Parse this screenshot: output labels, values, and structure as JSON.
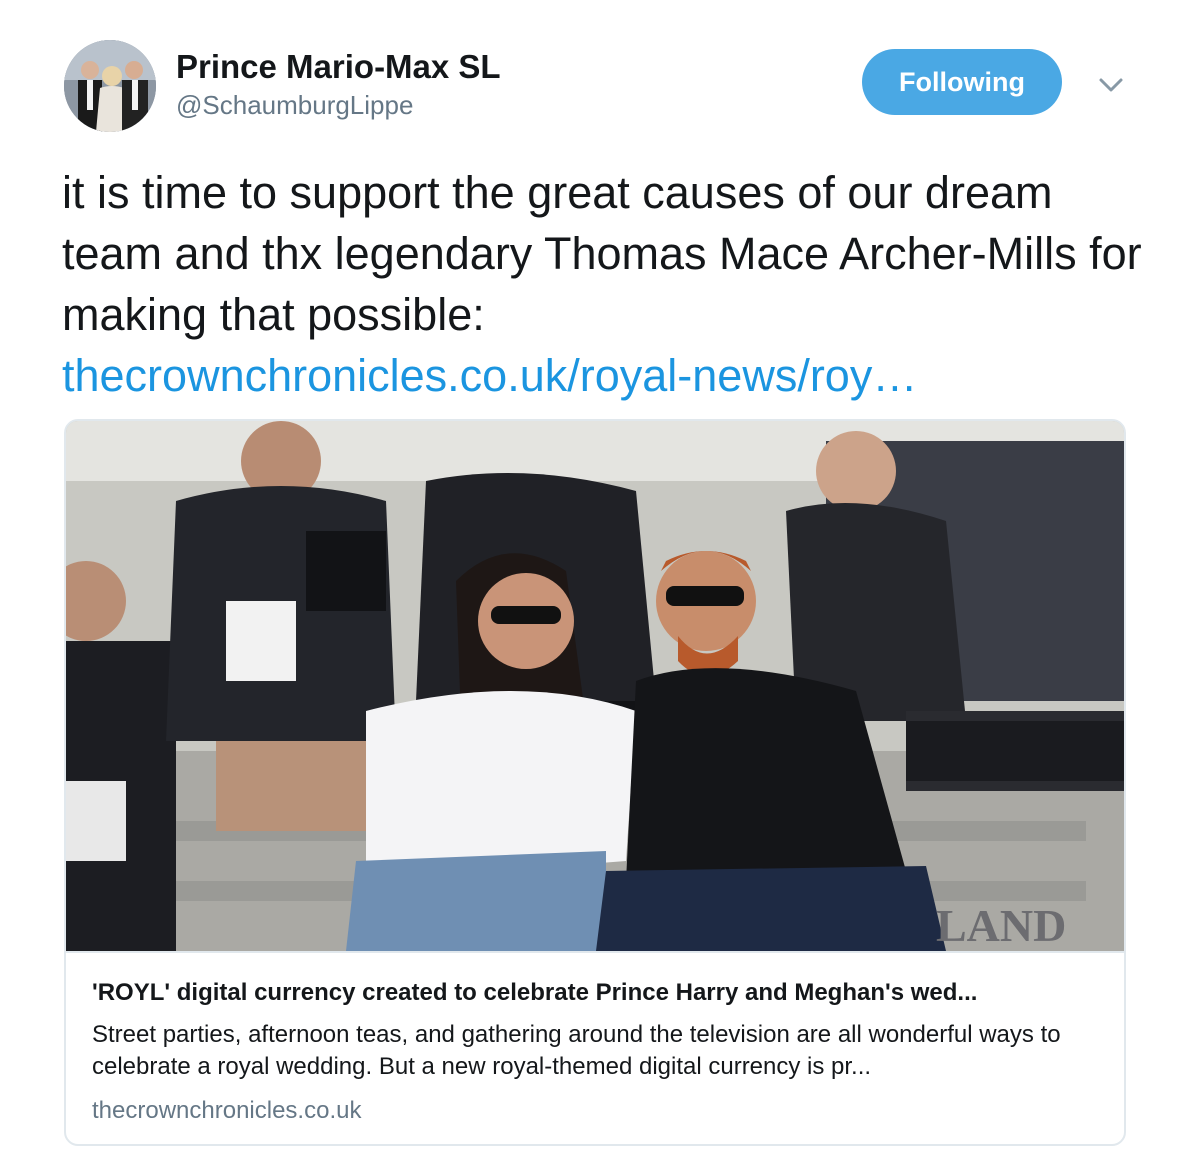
{
  "author": {
    "display_name": "Prince Mario-Max SL",
    "handle": "@SchaumburgLippe",
    "avatar_icon": "profile-photo"
  },
  "follow_button": {
    "label": "Following",
    "color": "#4aa8e4"
  },
  "menu_icon": "chevron-down-icon",
  "tweet": {
    "text": "it is time to support the great causes of our dream team and thx legendary Thomas Mace Archer-Mills for making that possible:",
    "link": "thecrownchronicles.co.uk/royal-news/roy…",
    "link_color": "#1b95e0"
  },
  "card": {
    "image_icon": "article-photo",
    "image_text": "LAND",
    "title": "'ROYL' digital currency created to celebrate Prince Harry and Meghan's wed...",
    "description": "Street parties, afternoon teas, and gathering around the television are all wonderful ways to celebrate a royal wedding. But a new royal-themed digital currency is pr...",
    "domain": "thecrownchronicles.co.uk"
  }
}
